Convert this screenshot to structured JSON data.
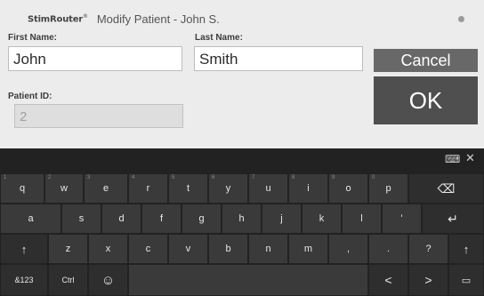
{
  "window": {
    "app_logo": "StimRouter",
    "app_logo_mark": "®",
    "title": "Modify Patient - John S."
  },
  "form": {
    "first_name_label": "First Name:",
    "first_name_value": "John",
    "last_name_label": "Last Name:",
    "last_name_value": "Smith",
    "patient_id_label": "Patient ID:",
    "patient_id_value": "2"
  },
  "buttons": {
    "cancel": "Cancel",
    "ok": "OK"
  },
  "keyboard": {
    "row1": [
      {
        "label": "q",
        "hint": "1"
      },
      {
        "label": "w",
        "hint": "2"
      },
      {
        "label": "e",
        "hint": "3"
      },
      {
        "label": "r",
        "hint": "4"
      },
      {
        "label": "t",
        "hint": "5"
      },
      {
        "label": "y",
        "hint": "6"
      },
      {
        "label": "u",
        "hint": "7"
      },
      {
        "label": "i",
        "hint": "8"
      },
      {
        "label": "o",
        "hint": "9"
      },
      {
        "label": "p",
        "hint": "0"
      },
      {
        "label": "⌫",
        "hint": ""
      }
    ],
    "row2": [
      "a",
      "s",
      "d",
      "f",
      "g",
      "h",
      "j",
      "k",
      "l",
      "'",
      "↵"
    ],
    "row3": [
      "↑",
      "z",
      "x",
      "c",
      "v",
      "b",
      "n",
      "m",
      ",",
      ".",
      "?",
      "↑"
    ],
    "row4": {
      "sym": "&123",
      "ctrl": "Ctrl",
      "emoji": "☺",
      "left": "<",
      "right": ">",
      "kbd": "▭"
    },
    "top_keyboard_icon": "⌨",
    "top_close_icon": "✕"
  }
}
